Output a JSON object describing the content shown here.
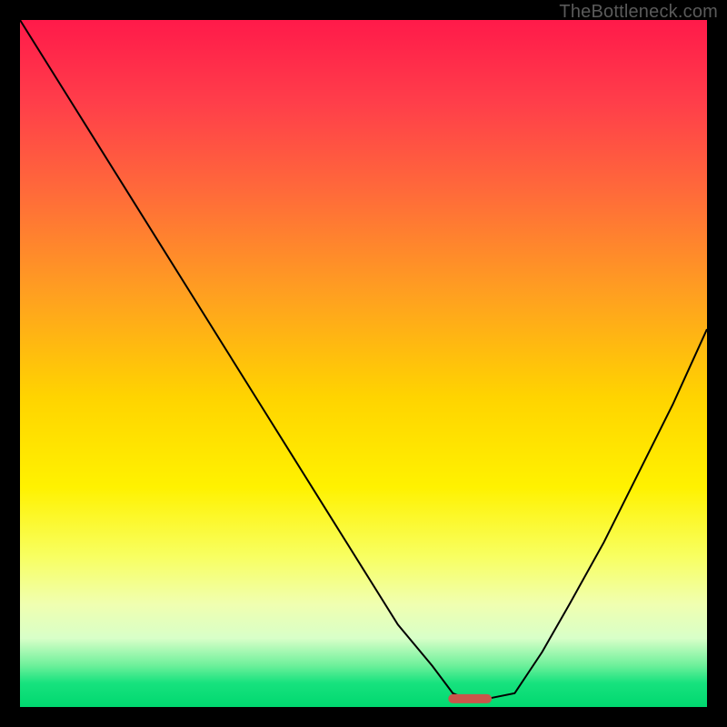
{
  "watermark": "TheBottleneck.com",
  "chart_data": {
    "type": "line",
    "title": "",
    "xlabel": "",
    "ylabel": "",
    "xlim": [
      0,
      100
    ],
    "ylim": [
      0,
      100
    ],
    "series": [
      {
        "name": "bottleneck-curve",
        "x": [
          0,
          5,
          10,
          15,
          20,
          25,
          30,
          35,
          40,
          45,
          50,
          55,
          60,
          63,
          65,
          68,
          72,
          76,
          80,
          85,
          90,
          95,
          100
        ],
        "values": [
          100,
          92,
          84,
          76,
          68,
          60,
          52,
          44,
          36,
          28,
          20,
          12,
          6,
          2,
          1.2,
          1.2,
          2,
          8,
          15,
          24,
          34,
          44,
          55
        ]
      },
      {
        "name": "sweet-spot",
        "x": [
          63,
          68
        ],
        "values": [
          1.2,
          1.2
        ]
      }
    ],
    "styles": {
      "bottleneck-curve": {
        "stroke": "#000000",
        "strokeWidth": 2
      },
      "sweet-spot": {
        "stroke": "#c9564a",
        "strokeWidth": 10,
        "linecap": "round"
      }
    },
    "background_gradient": {
      "top": "#ff1a4a",
      "upper_mid": "#ffd400",
      "lower_mid": "#f8ff60",
      "bottom": "#00d86f"
    }
  }
}
